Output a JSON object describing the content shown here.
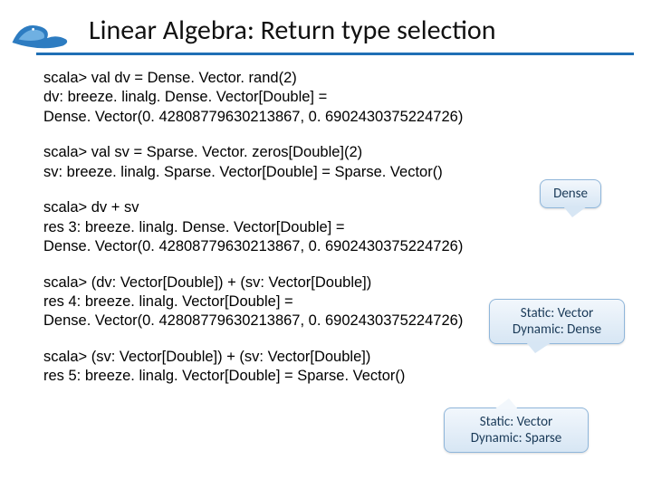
{
  "title": "Linear Algebra: Return type selection",
  "blocks": {
    "b1l1": "scala> val dv = Dense. Vector. rand(2)",
    "b1l2": "dv: breeze. linalg. Dense. Vector[Double] =",
    "b1l3": "Dense. Vector(0. 42808779630213867, 0. 6902430375224726)",
    "b2l1": "scala> val sv = Sparse. Vector. zeros[Double](2)",
    "b2l2": "sv: breeze. linalg. Sparse. Vector[Double] = Sparse. Vector()",
    "b3l1": "scala> dv + sv",
    "b3l2": "res 3: breeze. linalg. Dense. Vector[Double] =",
    "b3l3": "Dense. Vector(0. 42808779630213867, 0. 6902430375224726)",
    "b4l1": "scala> (dv: Vector[Double]) + (sv: Vector[Double])",
    "b4l2": "res 4: breeze. linalg. Vector[Double] =",
    "b4l3": "Dense. Vector(0. 42808779630213867, 0. 6902430375224726)",
    "b5l1": "scala> (sv: Vector[Double]) + (sv: Vector[Double])",
    "b5l2": "res 5: breeze. linalg. Vector[Double] = Sparse. Vector()"
  },
  "callouts": {
    "c1": "Dense",
    "c2l1": "Static: Vector",
    "c2l2": "Dynamic:  Dense",
    "c3l1": "Static: Vector",
    "c3l2": "Dynamic:  Sparse"
  }
}
